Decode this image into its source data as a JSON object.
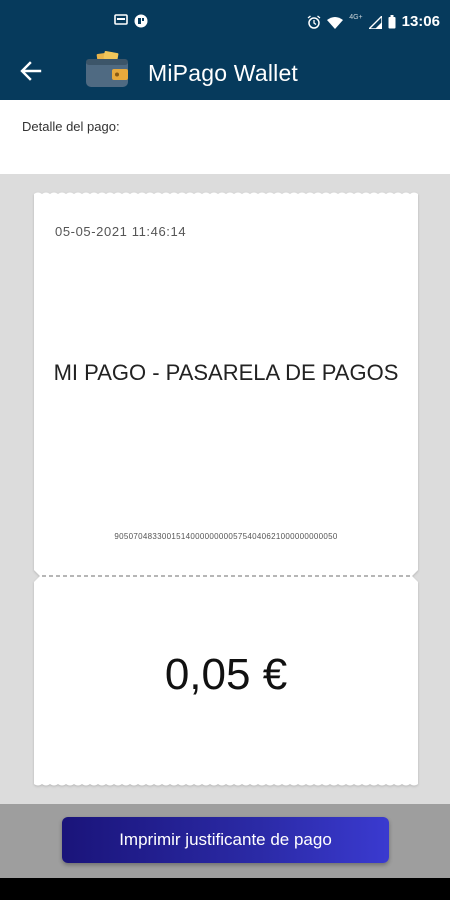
{
  "status_bar": {
    "time": "13:06",
    "network_label": "4G+",
    "left_icons": [
      "cast-icon",
      "app-notification-icon"
    ],
    "right_icons": [
      "alarm-icon",
      "wifi-icon",
      "signal-icon",
      "battery-icon"
    ],
    "background": "#063a5c"
  },
  "app_bar": {
    "title": "MiPago Wallet",
    "back_icon": "back-arrow-icon",
    "logo_icon": "wallet-icon",
    "background": "#063a5c"
  },
  "content": {
    "detail_label": "Detalle del pago:"
  },
  "receipt": {
    "date": "05-05-2021 11:46:14",
    "title": "MI PAGO - PASARELA DE PAGOS",
    "code": "90507048330015140000000005754040621000000000050",
    "amount": "0,05 €"
  },
  "actions": {
    "print_label": "Imprimir justificante de pago",
    "button_color": "#2b2aa6"
  }
}
